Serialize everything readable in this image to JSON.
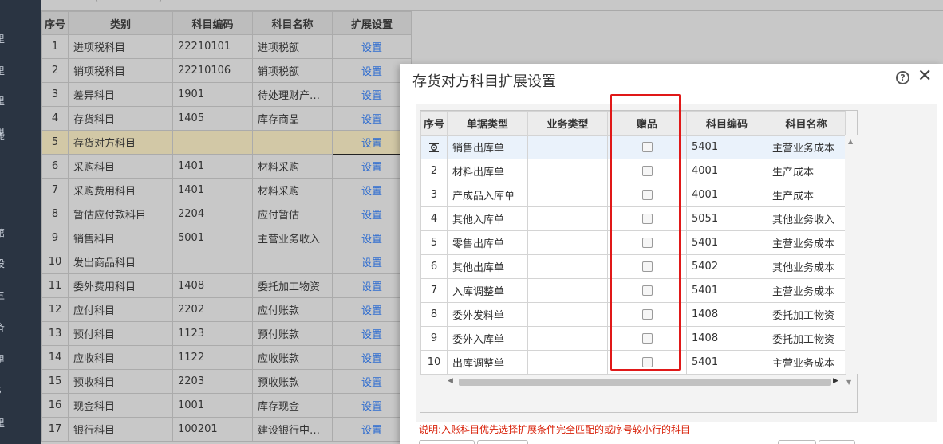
{
  "sidebar_fragments": [
    {
      "text": "里"
    },
    {
      "text": "里"
    },
    {
      "text": "里"
    },
    {
      "text": "里"
    },
    {
      "text": "能"
    },
    {
      "text": "館"
    },
    {
      "text": "设"
    },
    {
      "text": "五"
    },
    {
      "text": "斉"
    },
    {
      "text": "里"
    },
    {
      "text": "S"
    },
    {
      "text": "里"
    }
  ],
  "main_table": {
    "headers": [
      "序号",
      "类别",
      "科目编码",
      "科目名称",
      "扩展设置"
    ],
    "rows": [
      {
        "no": "1",
        "category": "进项税科目",
        "code": "22210101",
        "name": "进项税额",
        "action": "设置"
      },
      {
        "no": "2",
        "category": "销项税科目",
        "code": "22210106",
        "name": "销项税额",
        "action": "设置"
      },
      {
        "no": "3",
        "category": "差异科目",
        "code": "1901",
        "name": "待处理财产…",
        "action": "设置"
      },
      {
        "no": "4",
        "category": "存货科目",
        "code": "1405",
        "name": "库存商品",
        "action": "设置"
      },
      {
        "no": "5",
        "category": "存货对方科目",
        "code": "",
        "name": "",
        "action": "设置"
      },
      {
        "no": "6",
        "category": "采购科目",
        "code": "1401",
        "name": "材料采购",
        "action": "设置"
      },
      {
        "no": "7",
        "category": "采购费用科目",
        "code": "1401",
        "name": "材料采购",
        "action": "设置"
      },
      {
        "no": "8",
        "category": "暂估应付款科目",
        "code": "2204",
        "name": "应付暂估",
        "action": "设置"
      },
      {
        "no": "9",
        "category": "销售科目",
        "code": "5001",
        "name": "主营业务收入",
        "action": "设置"
      },
      {
        "no": "10",
        "category": "发出商品科目",
        "code": "",
        "name": "",
        "action": "设置"
      },
      {
        "no": "11",
        "category": "委外费用科目",
        "code": "1408",
        "name": "委托加工物资",
        "action": "设置"
      },
      {
        "no": "12",
        "category": "应付科目",
        "code": "2202",
        "name": "应付账款",
        "action": "设置"
      },
      {
        "no": "13",
        "category": "预付科目",
        "code": "1123",
        "name": "预付账款",
        "action": "设置"
      },
      {
        "no": "14",
        "category": "应收科目",
        "code": "1122",
        "name": "应收账款",
        "action": "设置"
      },
      {
        "no": "15",
        "category": "预收科目",
        "code": "2203",
        "name": "预收账款",
        "action": "设置"
      },
      {
        "no": "16",
        "category": "现金科目",
        "code": "1001",
        "name": "库存现金",
        "action": "设置"
      },
      {
        "no": "17",
        "category": "银行科目",
        "code": "100201",
        "name": "建设银行中…",
        "action": "设置"
      }
    ]
  },
  "dialog": {
    "title": "存货对方科目扩展设置",
    "help_glyph": "?",
    "close_glyph": "✕",
    "headers": [
      "序号",
      "单据类型",
      "业务类型",
      "赠品",
      "科目编码",
      "科目名称"
    ],
    "rows": [
      {
        "no": "",
        "bill_type": "销售出库单",
        "biz_type": "",
        "gift": false,
        "code": "5401",
        "name": "主营业务成本"
      },
      {
        "no": "2",
        "bill_type": "材料出库单",
        "biz_type": "",
        "gift": false,
        "code": "4001",
        "name": "生产成本"
      },
      {
        "no": "3",
        "bill_type": "产成品入库单",
        "biz_type": "",
        "gift": false,
        "code": "4001",
        "name": "生产成本"
      },
      {
        "no": "4",
        "bill_type": "其他入库单",
        "biz_type": "",
        "gift": false,
        "code": "5051",
        "name": "其他业务收入"
      },
      {
        "no": "5",
        "bill_type": "零售出库单",
        "biz_type": "",
        "gift": false,
        "code": "5401",
        "name": "主营业务成本"
      },
      {
        "no": "6",
        "bill_type": "其他出库单",
        "biz_type": "",
        "gift": false,
        "code": "5402",
        "name": "其他业务成本"
      },
      {
        "no": "7",
        "bill_type": "入库调整单",
        "biz_type": "",
        "gift": false,
        "code": "5401",
        "name": "主营业务成本"
      },
      {
        "no": "8",
        "bill_type": "委外发料单",
        "biz_type": "",
        "gift": false,
        "code": "1408",
        "name": "委托加工物资"
      },
      {
        "no": "9",
        "bill_type": "委外入库单",
        "biz_type": "",
        "gift": false,
        "code": "1408",
        "name": "委托加工物资"
      },
      {
        "no": "10",
        "bill_type": "出库调整单",
        "biz_type": "",
        "gift": false,
        "code": "5401",
        "name": "主营业务成本"
      }
    ],
    "note": "说明:入账科目优先选择扩展条件完全匹配的或序号较小行的科目"
  },
  "colors": {
    "sidebar": "#2a3442",
    "link": "#2c6bd0",
    "selected_row": "#d2c8a6",
    "highlight_box": "#e01818",
    "note": "#d81e06"
  }
}
